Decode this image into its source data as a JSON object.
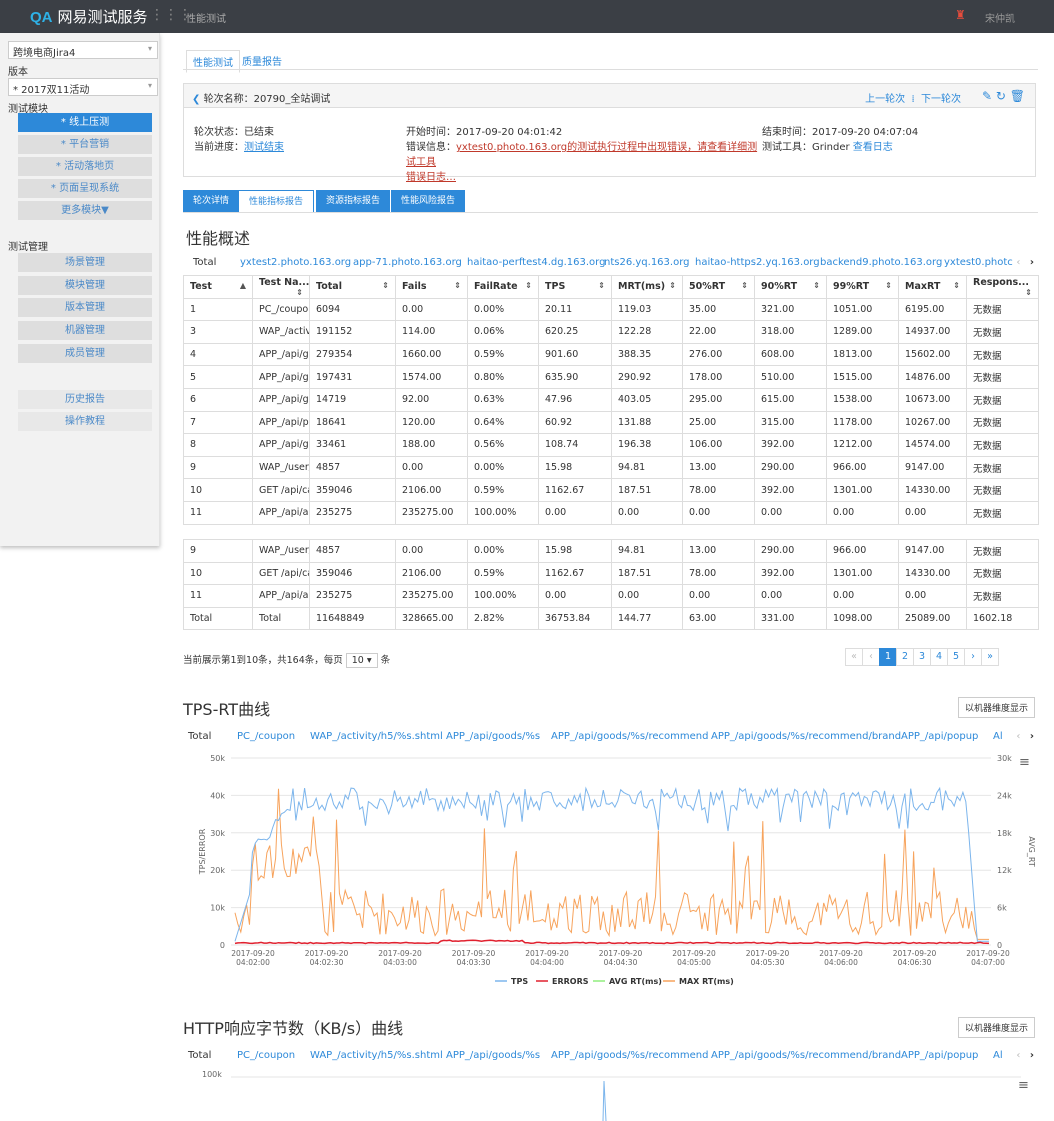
{
  "topbar": {
    "logo_mark": "QA",
    "logo_text": "网易测试服务",
    "crumb": "性能测试",
    "user": "宋仲凯"
  },
  "sidebar": {
    "project": "跨境电商Jira4",
    "version_label": "版本",
    "version": "* 2017双11活动",
    "modules_label": "测试模块",
    "modules": [
      "* 线上压测",
      "* 平台营销",
      "* 活动落地页",
      "* 页面呈现系统",
      "更多模块▼"
    ],
    "mgmt_label": "测试管理",
    "mgmt": [
      "场景管理",
      "模块管理",
      "版本管理",
      "机器管理",
      "成员管理"
    ],
    "extra": [
      "历史报告",
      "操作教程"
    ]
  },
  "tabs_top": [
    "性能测试",
    "质量报告"
  ],
  "round": {
    "title": "轮次名称：20790_全站调试",
    "prev": "上一轮次",
    "next": "下一轮次",
    "status_label": "轮次状态：",
    "status": "已结束",
    "progress_label": "当前进度：",
    "progress": "测试结束",
    "start_label": "开始时间：",
    "start": "2017-09-20 04:01:42",
    "error_label": "错误信息：",
    "error": "yxtest0.photo.163.org的测试执行过程中出现错误，请查看详细测试工具",
    "error2": "错误日志…",
    "end_label": "结束时间：",
    "end": "2017-09-20 04:07:04",
    "tool_label": "测试工具：",
    "tool": "Grinder",
    "tool_link": "查看日志"
  },
  "tabs_report": [
    "轮次详情",
    "性能指标报告",
    "资源指标报告",
    "性能风险报告"
  ],
  "perf": {
    "title": "性能概述",
    "hosts": [
      "Total",
      "yxtest2.photo.163.org",
      "app-71.photo.163.org",
      "haitao-perftest4.dg.163.org",
      "nts26.yq.163.org",
      "haitao-https2.yq.163.org",
      "backend9.photo.163.org",
      "yxtest0.photc"
    ],
    "columns": [
      "Test",
      "Test Na...",
      "Total",
      "Fails",
      "FailRate",
      "TPS",
      "MRT(ms)",
      "50%RT",
      "90%RT",
      "99%RT",
      "MaxRT",
      "Respons..."
    ],
    "rows": [
      [
        "1",
        "PC_/coupon",
        "6094",
        "0.00",
        "0.00%",
        "20.11",
        "119.03",
        "35.00",
        "321.00",
        "1051.00",
        "6195.00",
        "无数据"
      ],
      [
        "3",
        "WAP_/activi...",
        "191152",
        "114.00",
        "0.06%",
        "620.25",
        "122.28",
        "22.00",
        "318.00",
        "1289.00",
        "14937.00",
        "无数据"
      ],
      [
        "4",
        "APP_/api/g...",
        "279354",
        "1660.00",
        "0.59%",
        "901.60",
        "388.35",
        "276.00",
        "608.00",
        "1813.00",
        "15602.00",
        "无数据"
      ],
      [
        "5",
        "APP_/api/g...",
        "197431",
        "1574.00",
        "0.80%",
        "635.90",
        "290.92",
        "178.00",
        "510.00",
        "1515.00",
        "14876.00",
        "无数据"
      ],
      [
        "6",
        "APP_/api/g...",
        "14719",
        "92.00",
        "0.63%",
        "47.96",
        "403.05",
        "295.00",
        "615.00",
        "1538.00",
        "10673.00",
        "无数据"
      ],
      [
        "7",
        "APP_/api/p...",
        "18641",
        "120.00",
        "0.64%",
        "60.92",
        "131.88",
        "25.00",
        "315.00",
        "1178.00",
        "10267.00",
        "无数据"
      ],
      [
        "8",
        "APP_/api/g...",
        "33461",
        "188.00",
        "0.56%",
        "108.74",
        "196.38",
        "106.00",
        "392.00",
        "1212.00",
        "14574.00",
        "无数据"
      ],
      [
        "9",
        "WAP_/user/...",
        "4857",
        "0.00",
        "0.00%",
        "15.98",
        "94.81",
        "13.00",
        "290.00",
        "966.00",
        "9147.00",
        "无数据"
      ],
      [
        "10",
        "GET /api/cart",
        "359046",
        "2106.00",
        "0.59%",
        "1162.67",
        "187.51",
        "78.00",
        "392.00",
        "1301.00",
        "14330.00",
        "无数据"
      ],
      [
        "11",
        "APP_/api/ap...",
        "235275",
        "235275.00",
        "100.00%",
        "0.00",
        "0.00",
        "0.00",
        "0.00",
        "0.00",
        "0.00",
        "无数据"
      ]
    ],
    "rows_lower": [
      [
        "9",
        "WAP_/user/...",
        "4857",
        "0.00",
        "0.00%",
        "15.98",
        "94.81",
        "13.00",
        "290.00",
        "966.00",
        "9147.00",
        "无数据"
      ],
      [
        "10",
        "GET /api/cart",
        "359046",
        "2106.00",
        "0.59%",
        "1162.67",
        "187.51",
        "78.00",
        "392.00",
        "1301.00",
        "14330.00",
        "无数据"
      ],
      [
        "11",
        "APP_/api/ap...",
        "235275",
        "235275.00",
        "100.00%",
        "0.00",
        "0.00",
        "0.00",
        "0.00",
        "0.00",
        "0.00",
        "无数据"
      ],
      [
        "Total",
        "Total",
        "11648849",
        "328665.00",
        "2.82%",
        "36753.84",
        "144.77",
        "63.00",
        "331.00",
        "1098.00",
        "25089.00",
        "1602.18"
      ]
    ],
    "page_text_a": "当前展示第1到10条，共164条，每页",
    "page_size": "10 ▾",
    "page_text_b": "条",
    "pages": [
      "«",
      "‹",
      "1",
      "2",
      "3",
      "4",
      "5",
      "›",
      "»"
    ]
  },
  "tps": {
    "title": "TPS-RT曲线",
    "button": "以机器维度显示",
    "series_tabs": [
      "Total",
      "PC_/coupon",
      "WAP_/activity/h5/%s.shtml",
      "APP_/api/goods/%s",
      "APP_/api/goods/%s/recommend",
      "APP_/api/goods/%s/recommend/brand",
      "APP_/api/popup",
      "Al"
    ],
    "left_ticks": [
      "50k",
      "40k",
      "30k",
      "20k",
      "10k",
      "0"
    ],
    "right_ticks": [
      "30k",
      "24k",
      "18k",
      "12k",
      "6k",
      "0"
    ],
    "ylabel_left": "TPS/ERROR",
    "ylabel_right": "AVG_RT",
    "x_dates": [
      "2017-09-20",
      "2017-09-20",
      "2017-09-20",
      "2017-09-20",
      "2017-09-20",
      "2017-09-20",
      "2017-09-20",
      "2017-09-20",
      "2017-09-20",
      "2017-09-20",
      "2017-09-20"
    ],
    "x_times": [
      "04:02:00",
      "04:02:30",
      "04:03:00",
      "04:03:30",
      "04:04:00",
      "04:04:30",
      "04:05:00",
      "04:05:30",
      "04:06:00",
      "04:06:30",
      "04:07:00"
    ],
    "legend": [
      "TPS",
      "ERRORS",
      "AVG RT(ms)",
      "MAX RT(ms)"
    ],
    "colors": {
      "tps": "#7cb5ec",
      "errors": "#e0202e",
      "avg": "#90ed7d",
      "max": "#f7a35c"
    }
  },
  "http": {
    "title": "HTTP响应字节数（KB/s）曲线",
    "button": "以机器维度显示",
    "series_tabs": [
      "Total",
      "PC_/coupon",
      "WAP_/activity/h5/%s.shtml",
      "APP_/api/goods/%s",
      "APP_/api/goods/%s/recommend",
      "APP_/api/goods/%s/recommend/brand",
      "APP_/api/popup",
      "Al"
    ],
    "top_tick": "100k"
  }
}
